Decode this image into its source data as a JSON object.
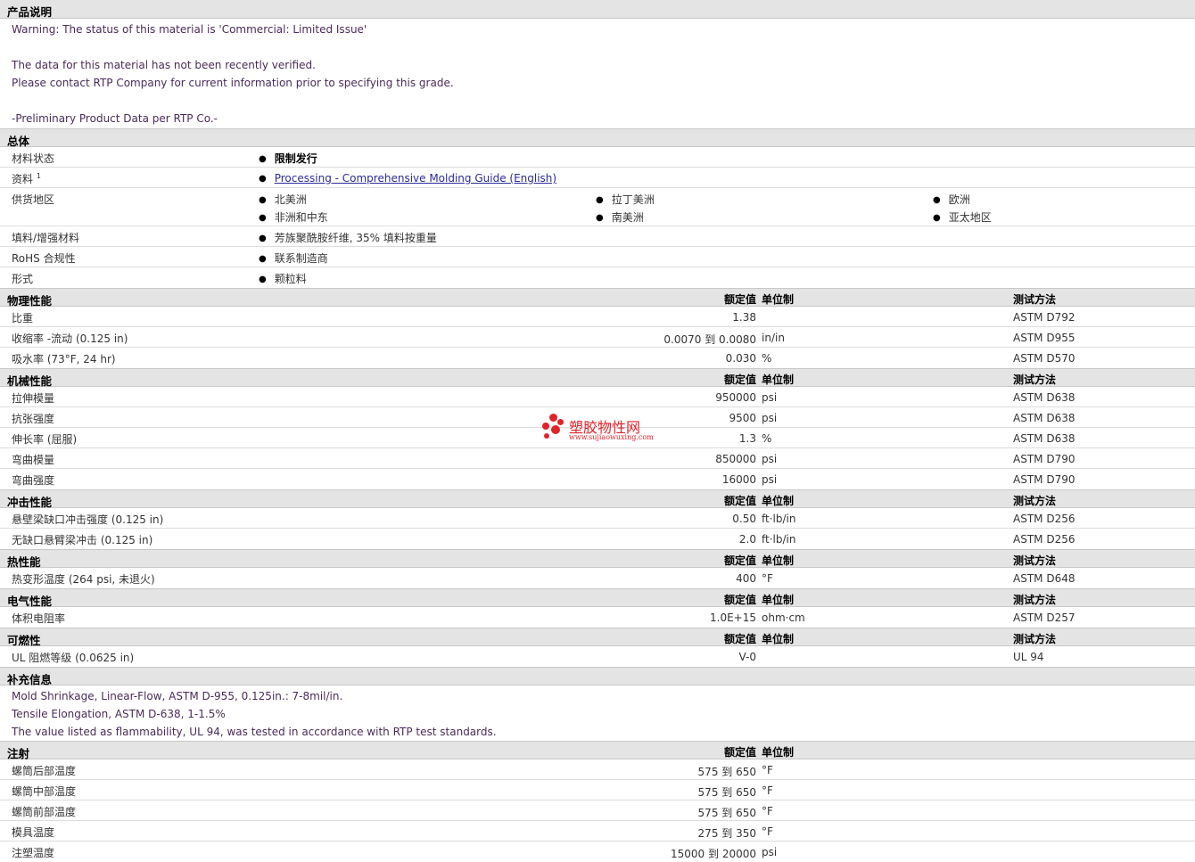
{
  "sections": {
    "desc": "产品说明",
    "general": "总体",
    "physical": "物理性能",
    "mechanical": "机械性能",
    "impact": "冲击性能",
    "thermal": "热性能",
    "electrical": "电气性能",
    "flammability": "可燃性",
    "supplemental": "补充信息",
    "injection": "注射"
  },
  "headers": {
    "nominal": "额定值",
    "unit": "单位制",
    "method": "测试方法"
  },
  "description": {
    "line1": "Warning: The status of this material is 'Commercial: Limited Issue'",
    "line2": "The data for this material has not been recently verified.",
    "line3": "Please contact RTP Company for current information prior to specifying this grade.",
    "line4": "-Preliminary Product Data per RTP Co.-"
  },
  "general": {
    "status_label": "材料状态",
    "status_value": "限制发行",
    "docs_label": "资料",
    "docs_sup": "1",
    "docs_value": "Processing - Comprehensive Molding Guide (English)",
    "region_label": "供货地区",
    "regions": [
      "北美洲",
      "拉丁美洲",
      "欧洲",
      "非洲和中东",
      "南美洲",
      "亚太地区"
    ],
    "filler_label": "填料/增强材料",
    "filler_value": "芳族聚酰胺纤维, 35% 填料按重量",
    "rohs_label": "RoHS 合规性",
    "rohs_value": "联系制造商",
    "form_label": "形式",
    "form_value": "颗粒料"
  },
  "physical": [
    {
      "label": "比重",
      "value": "1.38",
      "unit": "",
      "method": "ASTM D792"
    },
    {
      "label": "收缩率 -流动 (0.125 in)",
      "value": "0.0070 到 0.0080",
      "unit": "in/in",
      "method": "ASTM D955"
    },
    {
      "label": "吸水率 (73°F, 24 hr)",
      "value": "0.030",
      "unit": "%",
      "method": "ASTM D570"
    }
  ],
  "mechanical": [
    {
      "label": "拉伸模量",
      "value": "950000",
      "unit": "psi",
      "method": "ASTM D638"
    },
    {
      "label": "抗张强度",
      "value": "9500",
      "unit": "psi",
      "method": "ASTM D638"
    },
    {
      "label": "伸长率 (屈服)",
      "value": "1.3",
      "unit": "%",
      "method": "ASTM D638"
    },
    {
      "label": "弯曲模量",
      "value": "850000",
      "unit": "psi",
      "method": "ASTM D790"
    },
    {
      "label": "弯曲强度",
      "value": "16000",
      "unit": "psi",
      "method": "ASTM D790"
    }
  ],
  "impact": [
    {
      "label": "悬壁梁缺口冲击强度 (0.125 in)",
      "value": "0.50",
      "unit": "ft·lb/in",
      "method": "ASTM D256"
    },
    {
      "label": "无缺口悬臂梁冲击 (0.125 in)",
      "value": "2.0",
      "unit": "ft·lb/in",
      "method": "ASTM D256"
    }
  ],
  "thermal": [
    {
      "label": "热变形温度 (264 psi, 未退火)",
      "value": "400",
      "unit": "°F",
      "method": "ASTM D648"
    }
  ],
  "electrical": [
    {
      "label": "体积电阻率",
      "value": "1.0E+15",
      "unit": "ohm·cm",
      "method": "ASTM D257"
    }
  ],
  "flammability": [
    {
      "label": "UL 阻燃等级 (0.0625 in)",
      "value": "V-0",
      "unit": "",
      "method": "UL 94"
    }
  ],
  "supplemental": {
    "line1": "Mold Shrinkage, Linear-Flow, ASTM D-955, 0.125in.: 7-8mil/in.",
    "line2": "Tensile Elongation, ASTM D-638, 1-1.5%",
    "line3": "The value listed as flammability, UL 94, was tested in accordance with RTP test standards."
  },
  "injection": [
    {
      "label": "螺筒后部温度",
      "value": "575 到 650",
      "unit": "°F"
    },
    {
      "label": "螺筒中部温度",
      "value": "575 到 650",
      "unit": "°F"
    },
    {
      "label": "螺筒前部温度",
      "value": "575 到 650",
      "unit": "°F"
    },
    {
      "label": "模具温度",
      "value": "275 到 350",
      "unit": "°F"
    },
    {
      "label": "注塑温度",
      "value": "15000 到 20000",
      "unit": "psi"
    }
  ],
  "watermark": {
    "name": "塑胶物性网",
    "url": "www.sujiaowuxing.com"
  },
  "colors": {
    "header_bg": "#e4e4e4",
    "note_text": "#4a2a5a",
    "link": "#2a2a9a",
    "watermark": "#e0232a"
  }
}
